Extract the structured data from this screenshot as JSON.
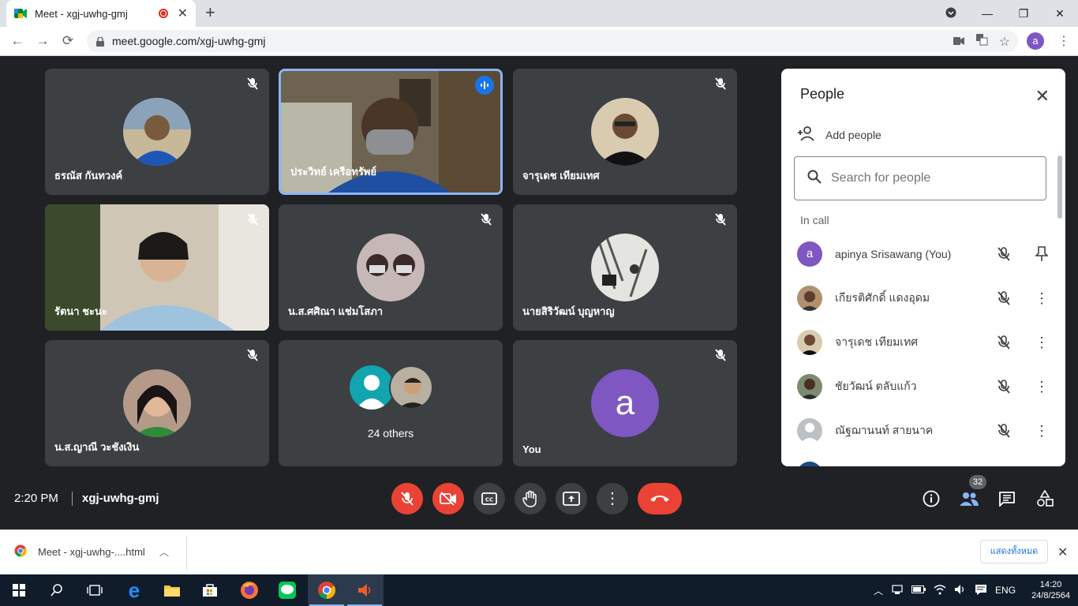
{
  "browser": {
    "tab_title": "Meet - xgj-uwhg-gmj",
    "url": "meet.google.com/xgj-uwhg-gmj",
    "profile_initial": "a"
  },
  "tiles": [
    {
      "name": "ธรณัส กันทวงค์",
      "bg": "#3c4043"
    },
    {
      "name": "ประวิทย์ เครือทรัพย์",
      "bg": "#7a6a55"
    },
    {
      "name": "จารุเดช เทียมเทศ",
      "bg": "#3c4043"
    },
    {
      "name": "รัตนา ชะนะ",
      "bg": "#d9d2c5"
    },
    {
      "name": "น.ส.ศศิณา แช่มโสภา",
      "bg": "#3c4043"
    },
    {
      "name": "นายสิริวัฒน์ บุญหาญ",
      "bg": "#3c4043"
    },
    {
      "name": "น.ส.ญาณี วะชังเงิน",
      "bg": "#3c4043"
    },
    {
      "name": "24 others",
      "bg": "#3c4043"
    },
    {
      "name": "You",
      "bg": "#3c4043"
    }
  ],
  "you_avatar_initial": "a",
  "people_panel": {
    "title": "People",
    "add_people": "Add people",
    "search_placeholder": "Search for people",
    "section": "In call",
    "people": [
      {
        "name": "apinya Srisawang (You)",
        "initial": "a"
      },
      {
        "name": "เกียรติศักดิ์ แดงอุดม"
      },
      {
        "name": "จารุเดช เทียมเทศ"
      },
      {
        "name": "ชัยวัฒน์ ตลับแก้ว"
      },
      {
        "name": "ณัฐฌานนท์ สายนาค"
      }
    ]
  },
  "bottom_bar": {
    "time": "2:20 PM",
    "meeting_code": "xgj-uwhg-gmj",
    "participant_count": "32"
  },
  "download": {
    "filename": "Meet - xgj-uwhg-....html",
    "show_all": "แสดงทั้งหมด"
  },
  "taskbar": {
    "lang": "ENG",
    "time": "14:20",
    "date": "24/8/2564"
  },
  "colors": {
    "accent": "#1a73e8",
    "end_call": "#ea4335",
    "background": "#202124",
    "tile": "#3c4043",
    "avatar_purple": "#7e57c2"
  }
}
